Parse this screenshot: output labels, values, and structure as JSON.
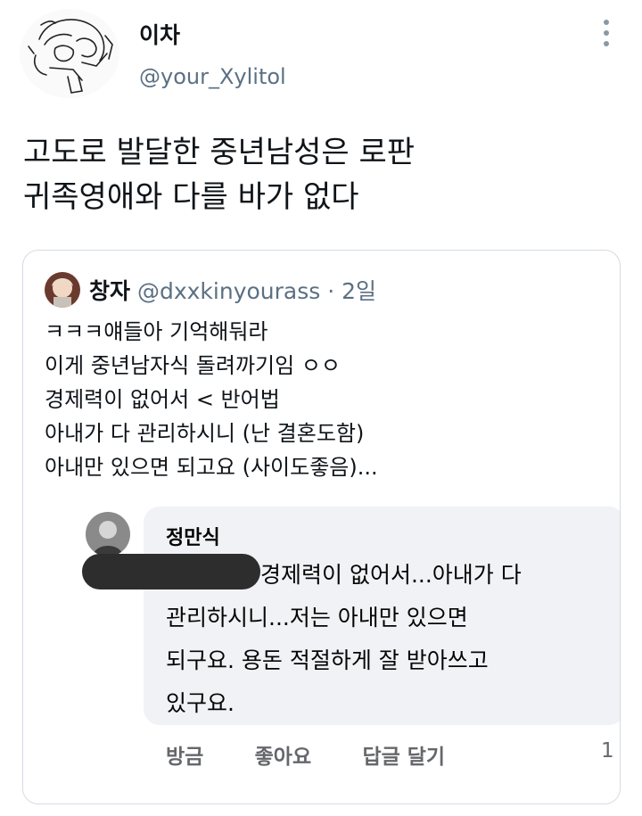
{
  "author": {
    "display_name": "이차",
    "handle": "@your_Xylitol"
  },
  "tweet": {
    "lines": [
      "고도로 발달한 중년남성은 로판",
      "귀족영애와 다를 바가 없다"
    ]
  },
  "quote": {
    "name": "창자",
    "handle": "@dxxkinyourass",
    "time": "· 2일",
    "lines": [
      "ㅋㅋㅋ얘들아 기억해둬라",
      "이게 중년남자식 돌려까기임 ㅇㅇ",
      "경제력이 없어서 < 반어법",
      "아내가 다 관리하시니 (난 결혼도함)",
      "아내만 있으면 되고요 (사이도좋음)..."
    ]
  },
  "comment": {
    "name": "정만식",
    "lines": [
      "경제력이 없어서...아내가 다",
      "관리하시니...저는 아내만 있으면",
      "되구요. 용돈 적절하게 잘 받아쓰고",
      "있구요."
    ],
    "actions": [
      "방금",
      "좋아요",
      "답글 달기"
    ],
    "count": "1"
  }
}
